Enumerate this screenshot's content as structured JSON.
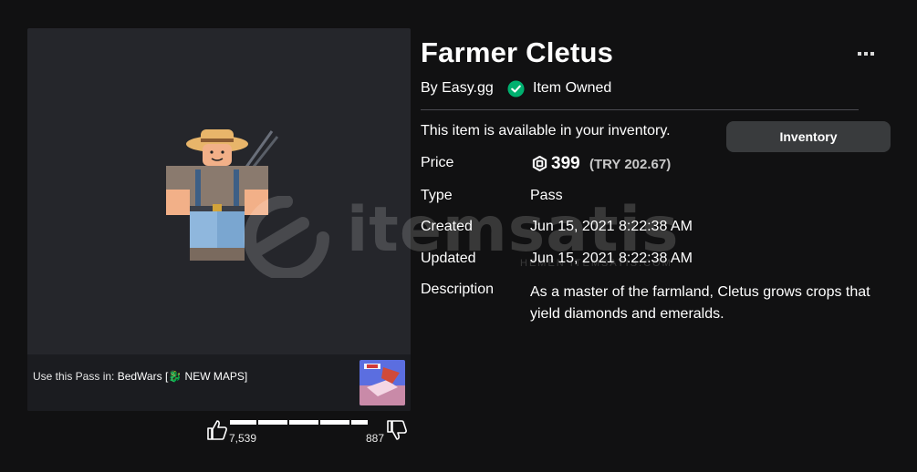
{
  "item": {
    "title": "Farmer Cletus",
    "creator": "By Easy.gg",
    "owned_label": "Item Owned",
    "availability": "This item is available in your inventory.",
    "inventory_button": "Inventory"
  },
  "details": {
    "price_label": "Price",
    "price_value": "399",
    "price_local": "(TRY 202.67)",
    "type_label": "Type",
    "type_value": "Pass",
    "created_label": "Created",
    "created_value": "Jun 15, 2021 8:22:38 AM",
    "updated_label": "Updated",
    "updated_value": "Jun 15, 2021 8:22:38 AM",
    "description_label": "Description",
    "description_value": "As a master of the farmland, Cletus grows crops that yield diamonds and emeralds."
  },
  "use_in": {
    "prefix": "Use this Pass in: ",
    "game_name": "BedWars [🐉 NEW MAPS]"
  },
  "votes": {
    "up_count": "7,539",
    "down_count": "887",
    "up_fraction": 0.895
  },
  "watermark": {
    "brand": "itemsatis",
    "sub": "HEMEN ITEMSATIS.COM"
  },
  "icons": {
    "more": "more-options-icon",
    "owned": "check-circle-icon",
    "robux": "robux-icon",
    "thumb_up": "thumbs-up-icon",
    "thumb_down": "thumbs-down-icon"
  },
  "colors": {
    "background": "#111112",
    "panel": "#25262b",
    "owned_green": "#00b06f",
    "button": "#393b3d"
  }
}
